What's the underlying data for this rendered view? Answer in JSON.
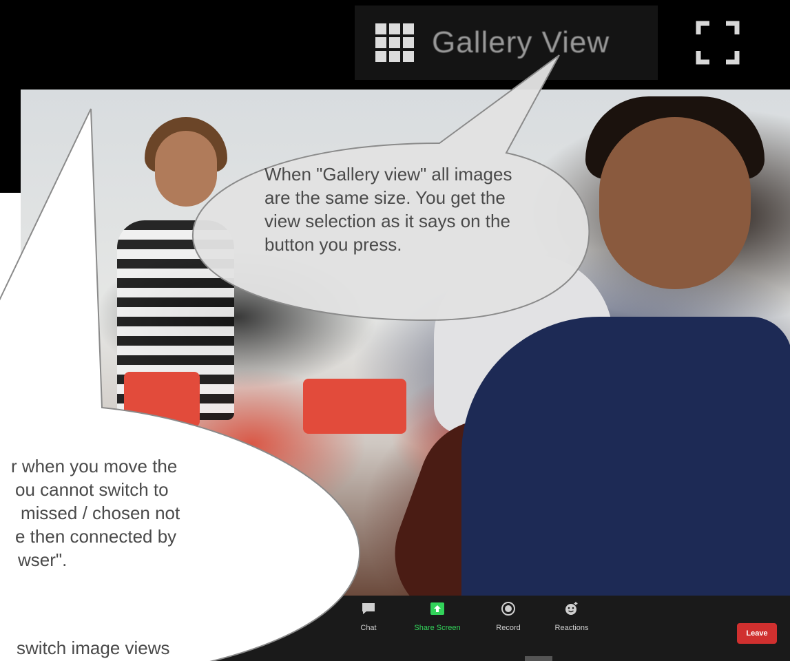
{
  "header": {
    "gallery_button": {
      "label": "Gallery View",
      "icon": "grid-icon"
    },
    "fullscreen_icon": "fullscreen-icon"
  },
  "toolbar": {
    "chat_label": "Chat",
    "share_label": "Share Screen",
    "record_label": "Record",
    "reactions_label": "Reactions",
    "leave_label": "Leave",
    "share_color": "#32d35a",
    "leave_color": "#d0302f"
  },
  "callouts": {
    "gallery_note": "When \"Gallery view\" all images are the same size. You get the view selection as it says on the button you press.",
    "left_note_line1": "r when you move the",
    "left_note_line2": "ou cannot switch to",
    "left_note_line3": "missed / chosen not",
    "left_note_line4": "e then connected by",
    "left_note_line5": "wser\".",
    "left_note_line6": "switch image views"
  }
}
